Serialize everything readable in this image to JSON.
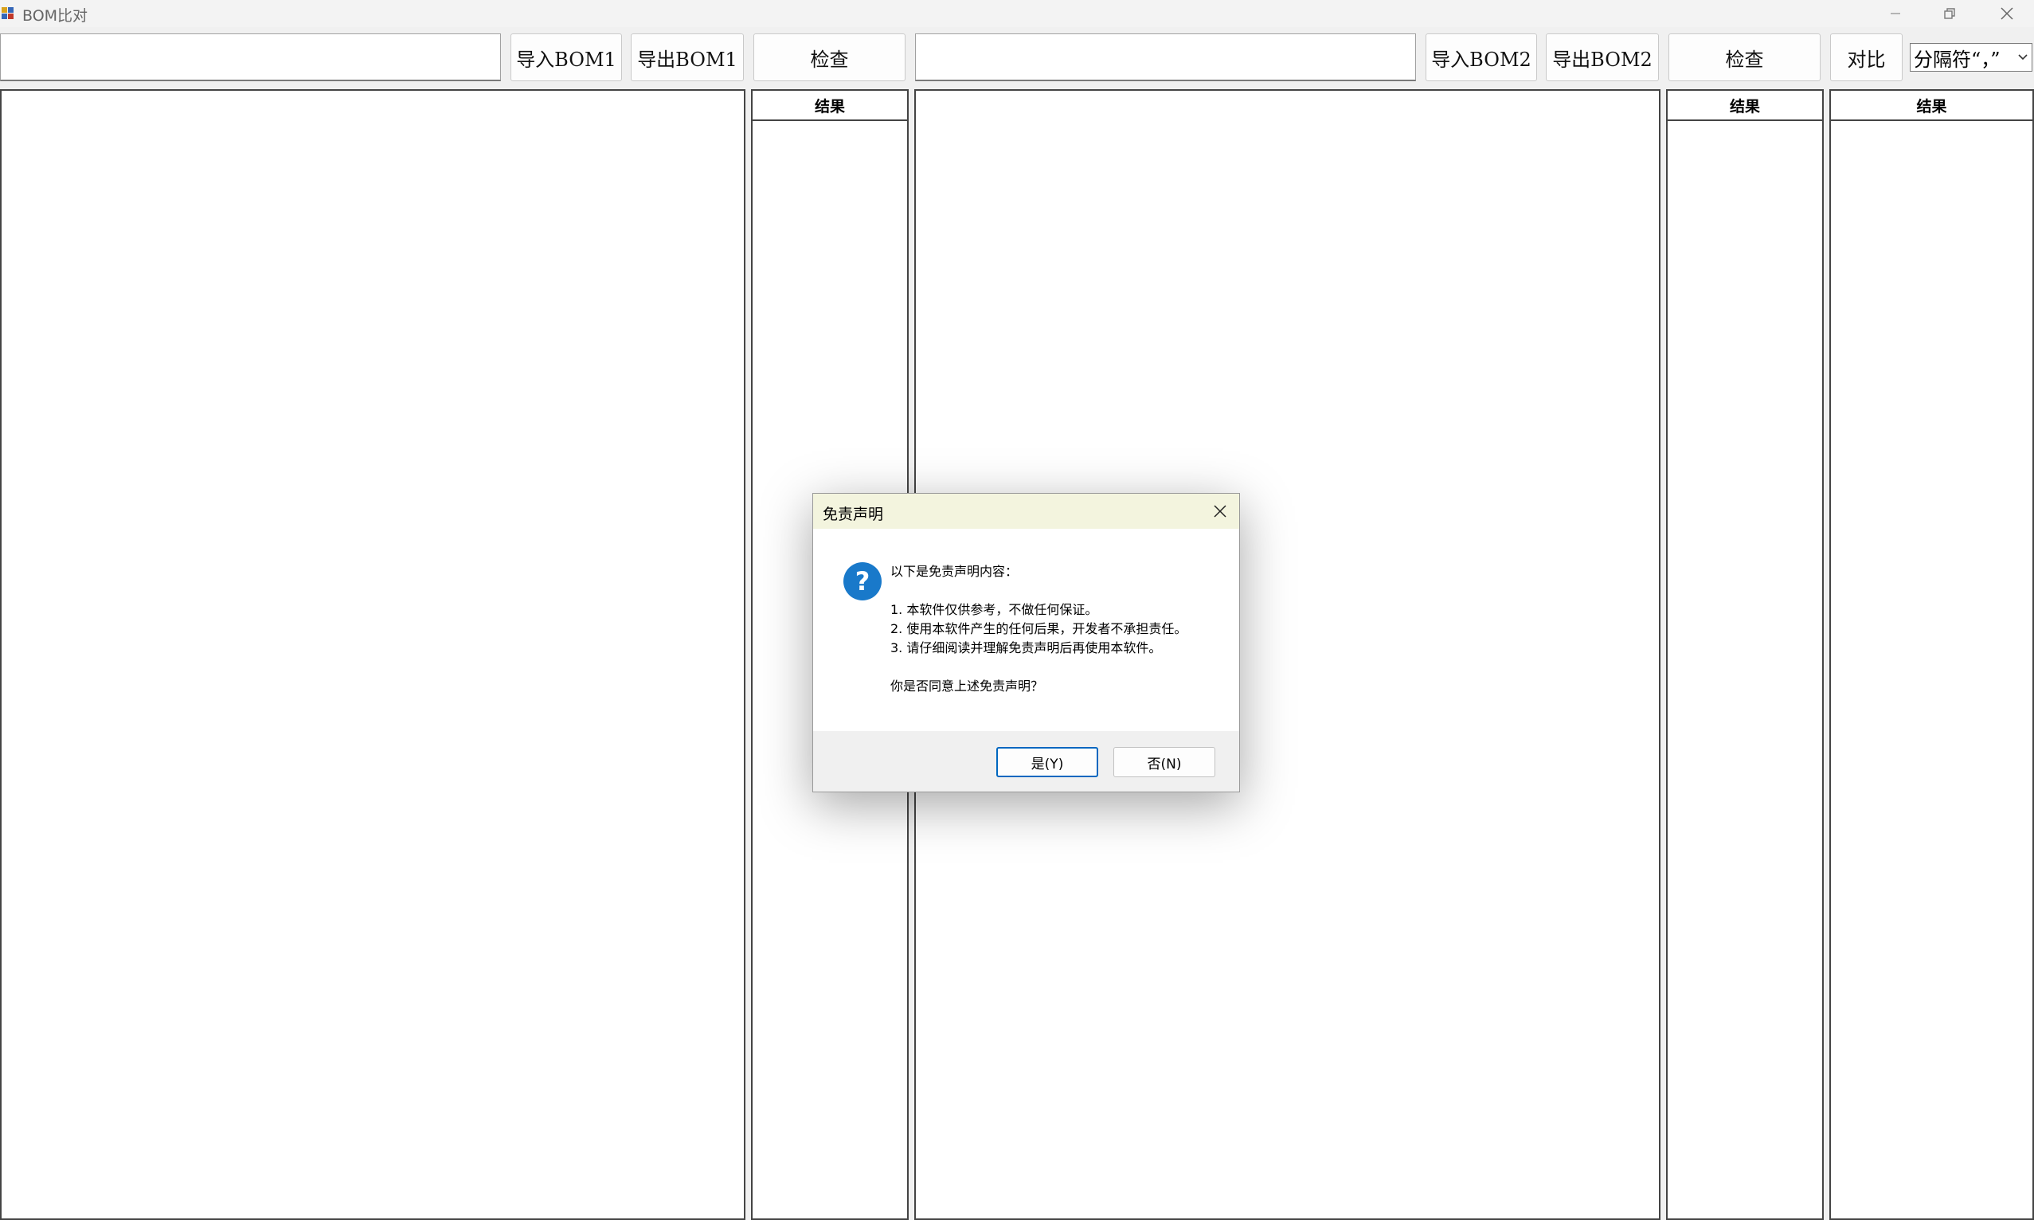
{
  "window": {
    "title": "BOM比对"
  },
  "toolbar": {
    "path1_value": "",
    "import1_label": "导入BOM1",
    "export1_label": "导出BOM1",
    "check1_label": "检查",
    "path2_value": "",
    "import2_label": "导入BOM2",
    "export2_label": "导出BOM2",
    "check2_label": "检查",
    "compare_label": "对比",
    "separator_selected": "分隔符“，”"
  },
  "panels": {
    "result1_header": "结果",
    "result2_header": "结果",
    "compare_result_header": "结果"
  },
  "dialog": {
    "title": "免责声明",
    "lines": [
      "以下是免责声明内容：",
      "1. 本软件仅供参考，不做任何保证。",
      "2. 使用本软件产生的任何后果，开发者不承担责任。",
      "3. 请仔细阅读并理解免责声明后再使用本软件。",
      "你是否同意上述免责声明？"
    ],
    "yes_label": "是(Y)",
    "no_label": "否(N)"
  },
  "icons": {
    "app": "app-icon",
    "dialog": "question-icon"
  },
  "colors": {
    "dialog_title_bg": "#f3f4de",
    "question_icon": "#1979ca",
    "primary_border": "#0067c0"
  }
}
